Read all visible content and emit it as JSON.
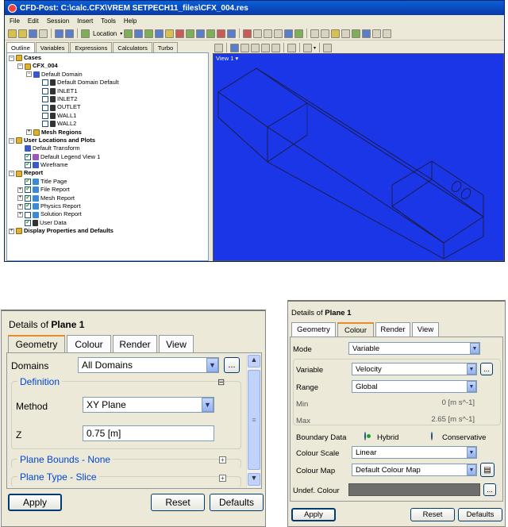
{
  "window": {
    "title": "CFD-Post: C:\\calc.CFX\\VREM SETPECH11_files\\CFX_004.res"
  },
  "menu": [
    "File",
    "Edit",
    "Session",
    "Insert",
    "Tools",
    "Help"
  ],
  "toolbar": {
    "location_label": "Location"
  },
  "outline_tabs": [
    "Outline",
    "Variables",
    "Expressions",
    "Calculators",
    "Turbo"
  ],
  "tree": [
    {
      "label": "Cases",
      "level": 0,
      "bold": true,
      "exp": "−",
      "icon": "fold"
    },
    {
      "label": "CFX_004",
      "level": 1,
      "bold": true,
      "exp": "−",
      "icon": "fold"
    },
    {
      "label": "Default Domain",
      "level": 2,
      "exp": "−",
      "icon": "dom"
    },
    {
      "label": "Default Domain Default",
      "level": 3,
      "chk": "off",
      "icon": "bnd"
    },
    {
      "label": "INLET1",
      "level": 3,
      "chk": "off",
      "icon": "bnd"
    },
    {
      "label": "INLET2",
      "level": 3,
      "chk": "off",
      "icon": "bnd"
    },
    {
      "label": "OUTLET",
      "level": 3,
      "chk": "off",
      "icon": "bnd"
    },
    {
      "label": "WALL1",
      "level": 3,
      "chk": "off",
      "icon": "bnd"
    },
    {
      "label": "WALL2",
      "level": 3,
      "chk": "off",
      "icon": "bnd"
    },
    {
      "label": "Mesh Regions",
      "level": 2,
      "bold": true,
      "exp": "+",
      "icon": "fold"
    },
    {
      "label": "User Locations and Plots",
      "level": 0,
      "bold": true,
      "exp": "−",
      "icon": "fold"
    },
    {
      "label": "Default Transform",
      "level": 1,
      "icon": "dom"
    },
    {
      "label": "Default Legend View 1",
      "level": 1,
      "chk": "on",
      "icon": "leg"
    },
    {
      "label": "Wireframe",
      "level": 1,
      "chk": "on",
      "icon": "dom"
    },
    {
      "label": "Report",
      "level": 0,
      "bold": true,
      "exp": "−",
      "icon": "fold"
    },
    {
      "label": "Title Page",
      "level": 1,
      "chk": "on",
      "icon": "rep"
    },
    {
      "label": "File Report",
      "level": 1,
      "exp": "+",
      "chk": "on",
      "icon": "rep"
    },
    {
      "label": "Mesh Report",
      "level": 1,
      "exp": "+",
      "chk": "on",
      "icon": "rep"
    },
    {
      "label": "Physics Report",
      "level": 1,
      "exp": "+",
      "chk": "on",
      "icon": "rep"
    },
    {
      "label": "Solution Report",
      "level": 1,
      "exp": "+",
      "chk": "off",
      "icon": "rep"
    },
    {
      "label": "User Data",
      "level": 1,
      "chk": "on",
      "icon": "bnd"
    },
    {
      "label": "Display Properties and Defaults",
      "level": 0,
      "bold": true,
      "exp": "+",
      "icon": "fold"
    }
  ],
  "viewer": {
    "label": "View 1"
  },
  "panel1": {
    "title_prefix": "Details of ",
    "title_obj": "Plane 1",
    "tabs": [
      "Geometry",
      "Colour",
      "Render",
      "View"
    ],
    "domains_label": "Domains",
    "domains_value": "All Domains",
    "definition_title": "Definition",
    "method_label": "Method",
    "method_value": "XY Plane",
    "z_label": "Z",
    "z_value": "0.75 [m]",
    "plane_bounds": "Plane Bounds - None",
    "plane_type": "Plane Type - Slice",
    "apply": "Apply",
    "reset": "Reset",
    "defaults": "Defaults",
    "more": "..."
  },
  "panel2": {
    "title_prefix": "Details of ",
    "title_obj": "Plane 1",
    "tabs": [
      "Geometry",
      "Colour",
      "Render",
      "View"
    ],
    "mode_label": "Mode",
    "mode_value": "Variable",
    "variable_label": "Variable",
    "variable_value": "Velocity",
    "range_label": "Range",
    "range_value": "Global",
    "min_label": "Min",
    "min_value": "0 [m s^-1]",
    "max_label": "Max",
    "max_value": "2.65 [m s^-1]",
    "boundary_label": "Boundary Data",
    "hybrid": "Hybrid",
    "conservative": "Conservative",
    "scale_label": "Colour Scale",
    "scale_value": "Linear",
    "map_label": "Colour Map",
    "map_value": "Default Colour Map",
    "undef_label": "Undef. Colour",
    "apply": "Apply",
    "reset": "Reset",
    "defaults": "Defaults",
    "more": "..."
  }
}
